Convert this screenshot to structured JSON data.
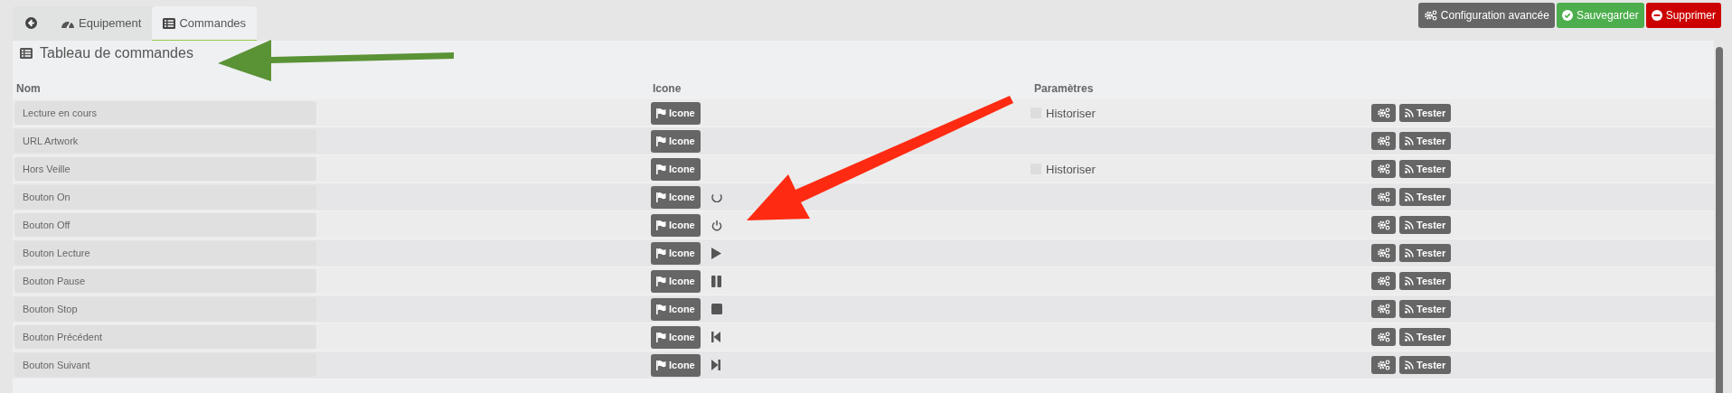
{
  "tabs": [
    {
      "kind": "back",
      "selected": false
    },
    {
      "kind": "gauge",
      "label": "Equipement",
      "selected": false
    },
    {
      "kind": "list",
      "label": "Commandes",
      "selected": true
    }
  ],
  "actions": [
    {
      "kind": "config",
      "label": "Configuration avancée"
    },
    {
      "kind": "save",
      "label": "Sauvegarder"
    },
    {
      "kind": "delete",
      "label": "Supprimer"
    }
  ],
  "panel": {
    "title": "Tableau de commandes"
  },
  "table": {
    "columns": [
      "Nom",
      "Icone",
      "Paramètres"
    ],
    "rows": [
      {
        "kind": "plain",
        "name": "Lecture en cours",
        "icon_button": "Icone",
        "test_button": "Tester",
        "historiser": {
          "label": "Historiser",
          "checked": false
        }
      },
      {
        "kind": "plain",
        "name": "URL Artwork",
        "icon_button": "Icone",
        "test_button": "Tester"
      },
      {
        "kind": "plain",
        "name": "Hors Veille",
        "icon_button": "Icone",
        "test_button": "Tester",
        "historiser": {
          "label": "Historiser",
          "checked": false
        }
      },
      {
        "kind": "refresh",
        "name": "Bouton On",
        "icon_button": "Icone",
        "test_button": "Tester"
      },
      {
        "kind": "power",
        "name": "Bouton Off",
        "icon_button": "Icone",
        "test_button": "Tester"
      },
      {
        "kind": "play",
        "name": "Bouton Lecture",
        "icon_button": "Icone",
        "test_button": "Tester"
      },
      {
        "kind": "pause",
        "name": "Bouton Pause",
        "icon_button": "Icone",
        "test_button": "Tester"
      },
      {
        "kind": "stop",
        "name": "Bouton Stop",
        "icon_button": "Icone",
        "test_button": "Tester"
      },
      {
        "kind": "previous",
        "name": "Bouton Précédent",
        "icon_button": "Icone",
        "test_button": "Tester"
      },
      {
        "kind": "next",
        "name": "Bouton Suivant",
        "icon_button": "Icone",
        "test_button": "Tester"
      }
    ]
  }
}
